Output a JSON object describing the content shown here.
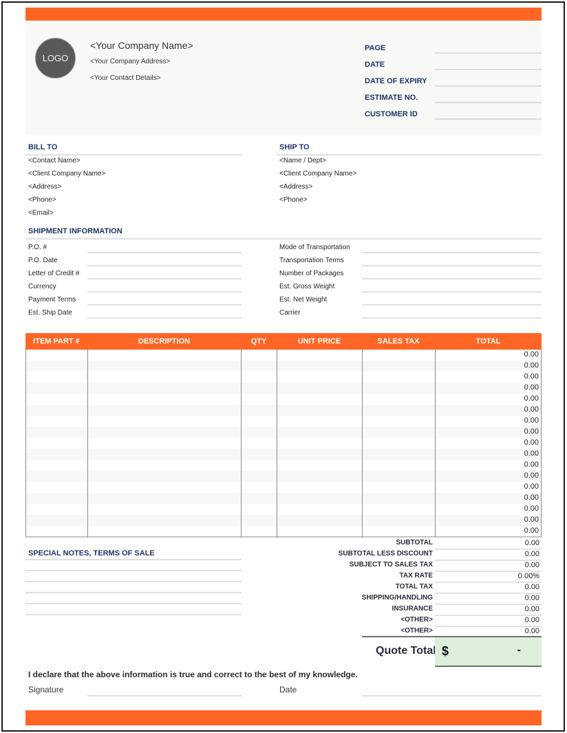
{
  "colors": {
    "accent": "#ff6626",
    "heading": "#1f3566",
    "quote_total_bg": "#dcefdb"
  },
  "company": {
    "logo_text": "LOGO",
    "name": "<Your Company Name>",
    "address": "<Your Company Address>",
    "contact": "<Your Contact Details>"
  },
  "meta_fields": [
    {
      "label": "PAGE",
      "value": ""
    },
    {
      "label": "DATE",
      "value": ""
    },
    {
      "label": "DATE OF EXPIRY",
      "value": ""
    },
    {
      "label": "ESTIMATE NO.",
      "value": ""
    },
    {
      "label": "CUSTOMER ID",
      "value": ""
    }
  ],
  "bill_to": {
    "heading": "BILL TO",
    "lines": [
      "<Contact Name>",
      "<Client Company Name>",
      "<Address>",
      "<Phone>",
      "<Email>"
    ]
  },
  "ship_to": {
    "heading": "SHIP TO",
    "lines": [
      "<Name / Dept>",
      "<Client Company Name>",
      "<Address>",
      "<Phone>"
    ]
  },
  "shipment": {
    "heading": "SHIPMENT INFORMATION",
    "left_fields": [
      {
        "label": "P.O. #",
        "value": ""
      },
      {
        "label": "P.O. Date",
        "value": ""
      },
      {
        "label": "Letter of Credit #",
        "value": ""
      },
      {
        "label": "Currency",
        "value": ""
      },
      {
        "label": "Payment Terms",
        "value": ""
      },
      {
        "label": "Est. Ship Date",
        "value": ""
      }
    ],
    "right_fields": [
      {
        "label": "Mode of Transportation",
        "value": ""
      },
      {
        "label": "Transportation Terms",
        "value": ""
      },
      {
        "label": "Number of Packages",
        "value": ""
      },
      {
        "label": "Est. Gross Weight",
        "value": ""
      },
      {
        "label": "Est. Net Weight",
        "value": ""
      },
      {
        "label": "Carrier",
        "value": ""
      }
    ]
  },
  "items_table": {
    "columns": [
      "ITEM PART #",
      "DESCRIPTION",
      "QTY",
      "UNIT PRICE",
      "SALES TAX",
      "TOTAL"
    ],
    "rows": [
      {
        "total": "0.00"
      },
      {
        "total": "0.00"
      },
      {
        "total": "0.00"
      },
      {
        "total": "0.00"
      },
      {
        "total": "0.00"
      },
      {
        "total": "0.00"
      },
      {
        "total": "0.00"
      },
      {
        "total": "0.00"
      },
      {
        "total": "0.00"
      },
      {
        "total": "0.00"
      },
      {
        "total": "0.00"
      },
      {
        "total": "0.00"
      },
      {
        "total": "0.00"
      },
      {
        "total": "0.00"
      },
      {
        "total": "0.00"
      },
      {
        "total": "0.00"
      },
      {
        "total": "0.00"
      }
    ]
  },
  "notes": {
    "heading": "SPECIAL NOTES, TERMS OF SALE"
  },
  "summary": [
    {
      "label": "SUBTOTAL",
      "value": "0.00"
    },
    {
      "label": "SUBTOTAL LESS DISCOUNT",
      "value": "0.00"
    },
    {
      "label": "SUBJECT TO SALES TAX",
      "value": "0.00"
    },
    {
      "label": "TAX RATE",
      "value": "0.00%"
    },
    {
      "label": "TOTAL TAX",
      "value": "0.00"
    },
    {
      "label": "SHIPPING/HANDLING",
      "value": "0.00"
    },
    {
      "label": "INSURANCE",
      "value": "0.00"
    },
    {
      "label": "<OTHER>",
      "value": "0.00"
    },
    {
      "label": "<OTHER>",
      "value": "0.00"
    }
  ],
  "quote_total": {
    "label": "Quote Total",
    "currency": "$",
    "value": "-"
  },
  "declaration": "I declare that the above information is true and correct to the best of my knowledge.",
  "signature": {
    "signature_label": "Signature",
    "date_label": "Date"
  }
}
